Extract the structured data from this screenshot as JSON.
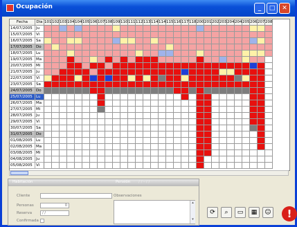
{
  "window": {
    "title": "Ocupación",
    "minimize": "_",
    "maximize": "□",
    "close": "✕"
  },
  "grid": {
    "header_date": "Fecha",
    "header_day": "Dia",
    "rooms": [
      "101",
      "102",
      "103",
      "104",
      "104B",
      "105",
      "106",
      "107",
      "108",
      "109",
      "110",
      "111",
      "112",
      "113",
      "114",
      "114B",
      "115",
      "116",
      "117",
      "118",
      "200",
      "201",
      "202",
      "203",
      "204",
      "204B",
      "205",
      "206",
      "207",
      "208"
    ],
    "rooms_visible_labels": [
      "101",
      "102",
      "103",
      "104",
      "104E",
      "105",
      "106",
      "107",
      "108",
      "109",
      "110",
      "111",
      "112",
      "113",
      "114",
      "114D",
      "115",
      "116",
      "117",
      "118",
      "200",
      "201",
      "202",
      "203",
      "204",
      "204E",
      "205",
      "206",
      "207",
      "208"
    ],
    "rows": [
      {
        "date": "14/07/2005",
        "day": "Ju",
        "style": ""
      },
      {
        "date": "15/07/2005",
        "day": "Vi",
        "style": ""
      },
      {
        "date": "16/07/2005",
        "day": "Sa",
        "style": ""
      },
      {
        "date": "17/07/2005",
        "day": "Do",
        "style": "hl"
      },
      {
        "date": "18/07/2005",
        "day": "Lu",
        "style": ""
      },
      {
        "date": "19/07/2005",
        "day": "Ma",
        "style": ""
      },
      {
        "date": "20/07/2005",
        "day": "Mi",
        "style": ""
      },
      {
        "date": "21/07/2005",
        "day": "Ju",
        "style": ""
      },
      {
        "date": "22/07/2005",
        "day": "Vi",
        "style": ""
      },
      {
        "date": "23/07/2005",
        "day": "Sa",
        "style": ""
      },
      {
        "date": "24/07/2005",
        "day": "Do",
        "style": "hl"
      },
      {
        "date": "25/07/2005",
        "day": "Lu",
        "style": "sel"
      },
      {
        "date": "26/07/2005",
        "day": "Ma",
        "style": ""
      },
      {
        "date": "27/07/2005",
        "day": "Mi",
        "style": ""
      },
      {
        "date": "28/07/2005",
        "day": "Ju",
        "style": ""
      },
      {
        "date": "29/07/2005",
        "day": "Vi",
        "style": ""
      },
      {
        "date": "30/07/2005",
        "day": "Sa",
        "style": ""
      },
      {
        "date": "31/07/2005",
        "day": "Do",
        "style": "hl"
      },
      {
        "date": "01/08/2005",
        "day": "Lu",
        "style": ""
      },
      {
        "date": "02/08/2005",
        "day": "Ma",
        "style": ""
      },
      {
        "date": "03/08/2005",
        "day": "Mi",
        "style": ""
      },
      {
        "date": "04/08/2005",
        "day": "Ju",
        "style": ""
      },
      {
        "date": "05/08/2005",
        "day": "Vi",
        "style": ""
      }
    ],
    "palette": {
      "w": "#ffffff",
      "p": "#f5a3a3",
      "y": "#fff2a8",
      "b": "#9fb3ea",
      "r": "#e8100e",
      "g": "#7d7d7d",
      "n": "#1f3fd6",
      "o": "#f1c400"
    },
    "matrix": [
      "ppbpbppppyppppppppppbppppppyyp",
      "ppppppppppppppppppppppppppppppp",
      "yppyyppppbyyppyppppppppppppbyp",
      "pyppppppppppppppyppppppppppppp",
      "pppyppppppppyppbbpppypppppyyyp",
      "ppprppyprprprrrppppprppbppypp",
      "ppprrprrprrrrrrrrrrrrrrrrrrnr",
      "pprrrrprrrrrrrrrrrnrrrryyrrrr",
      "yrrryrnrnrryryrgrryrrrrrrgyrr",
      "rrrrrrrrrrrrrrrrrrrrrrrrrrrrr",
      "ggggggrrgggggggggrrgrggggggrr",
      "wwwwwwwrwwwwwwwwwwrwrrwwwwwrrw",
      "wwwwwwwrwwwwwwwwwwwwrrwwwwwrrw",
      "wwwwwwwgwwwwwwwwwwwwrrwwwwwrrw",
      "wwwwwwwwwwwwwwwwwwwwrrwwwwwrrw",
      "wwwwwwwwwwwwwwwwwwwwrrwwwwwrrw",
      "wwwwwwwwwwwwwwwwwwwwrrwwwwwgrw",
      "wwwwwwwwwwwwwwwwwwwwrrwwwwwwrw",
      "wwwwwwwwwwwwwwwwwwwwrrwwwwwwrw",
      "wwwwwwwwwwwwwwwwwwwwrrwwwwwwrw",
      "wwwwwwwwwwwwwwwwwwwwrrwwwwwwww",
      "wwwwwwwwwwwwwwwwwwwwrwwwwwwwww",
      "wwwwwwwwwwwwwwwwwwwwrwwwwwwwww"
    ]
  },
  "panel": {
    "section_left": "Habitación",
    "section_right": "Pensión",
    "pension_dates": "/ /   -   / /",
    "cliente_label": "Cliente",
    "personas_label": "Personas",
    "personas_value": "0",
    "reserva_label": "Reserva",
    "reserva_value": "/ /",
    "confirmada_label": "Confirmada",
    "observaciones_label": "Observaciones"
  },
  "toolbar": {
    "icons": [
      "refresh-icon",
      "search-icon",
      "print-icon",
      "calendar-icon",
      "users-icon"
    ],
    "alert": "!"
  }
}
